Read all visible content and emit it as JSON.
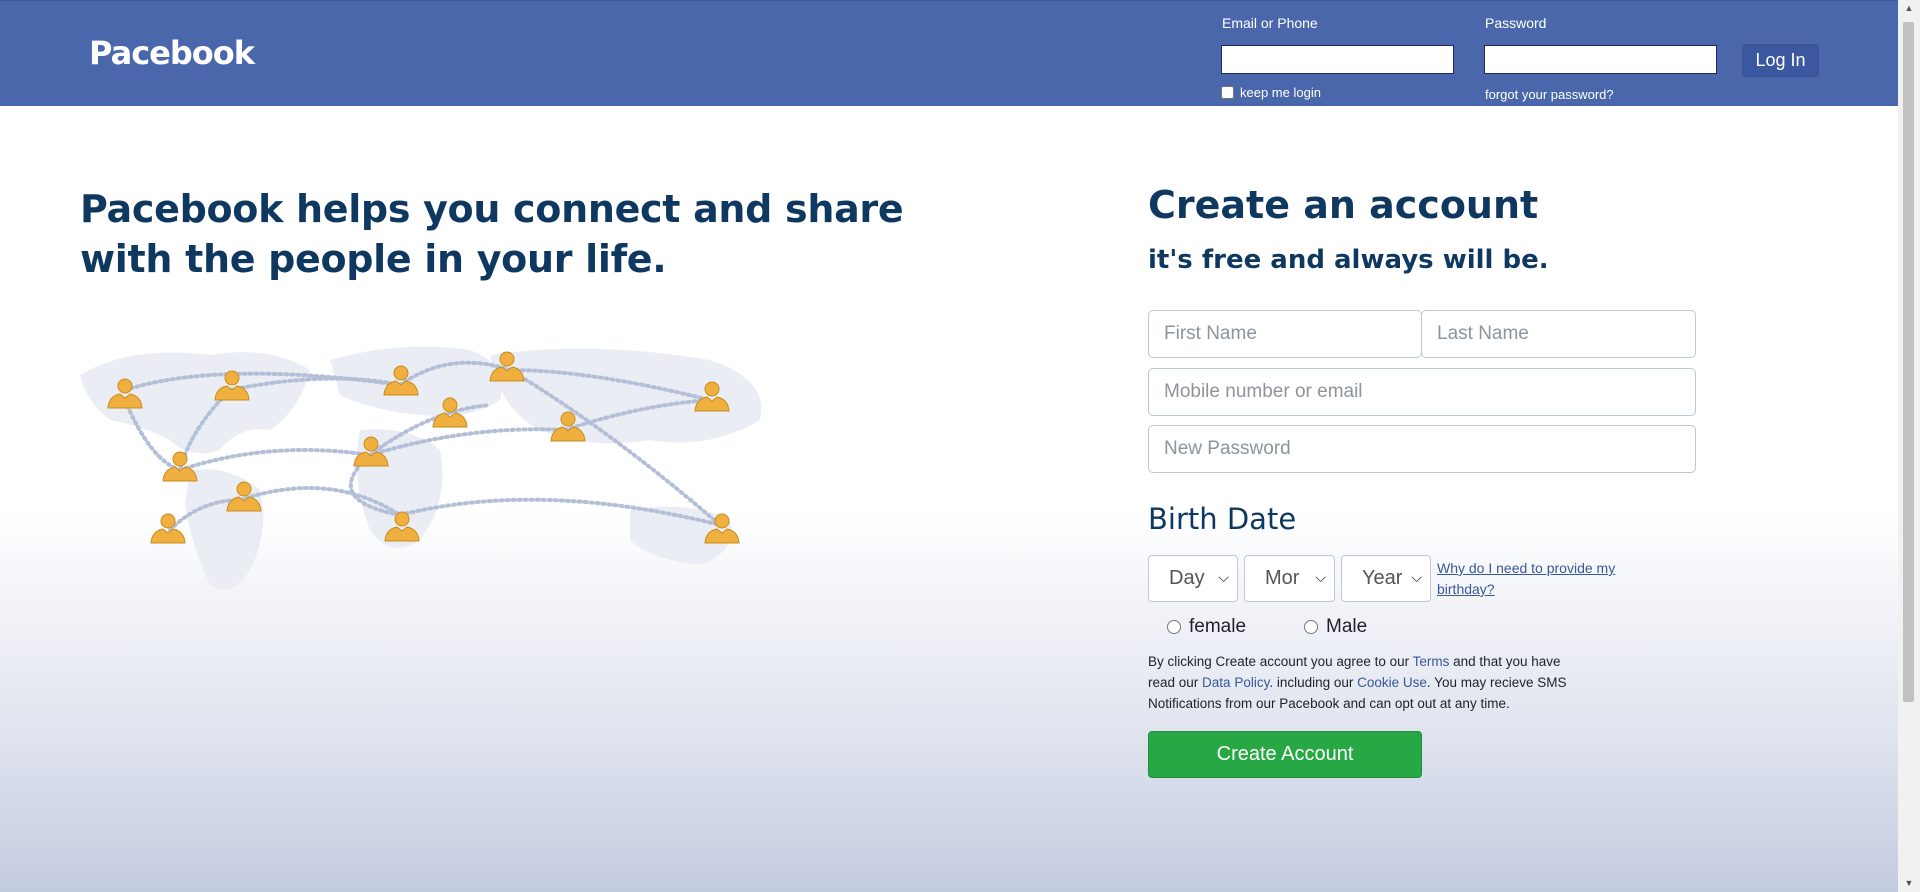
{
  "header": {
    "logo": "Pacebook",
    "email_label": "Email or Phone",
    "password_label": "Password",
    "email_value": "",
    "password_value": "",
    "keep_login": "keep me login",
    "forgot_password": "forgot your password?",
    "login_button": "Log In"
  },
  "hero": {
    "headline": "Pacebook helps you connect and share with the people in your life."
  },
  "signup": {
    "title": "Create an account",
    "subtitle": "it's free and always will be.",
    "first_name_placeholder": "First Name",
    "last_name_placeholder": "Last Name",
    "mobile_placeholder": "Mobile number or email",
    "password_placeholder": "New Password",
    "birth_title": "Birth Date",
    "day": "Day",
    "month": "Mor",
    "year": "Year",
    "why_birthday": "Why do I need to provide my birthday?",
    "gender_female": "female",
    "gender_male": "Male",
    "terms": {
      "p1": "By clicking Create account you agree to our ",
      "terms_link": "Terms",
      "p2": " and that you have read our ",
      "policy_link": "Data Policy",
      "p3": ". including our ",
      "cookie_link": "Cookie Use",
      "p4": ". You may recieve SMS Notifications from our Pacebook and can opt out at any time."
    },
    "create_button": "Create Account"
  },
  "colors": {
    "header_bg": "#4a67ab",
    "heading_text": "#0e385f",
    "create_button": "#28a745",
    "link": "#385898",
    "person_icon": "#f0b03f"
  },
  "icons": [
    "world-map-icon",
    "person-icon",
    "chevron-down-icon"
  ]
}
